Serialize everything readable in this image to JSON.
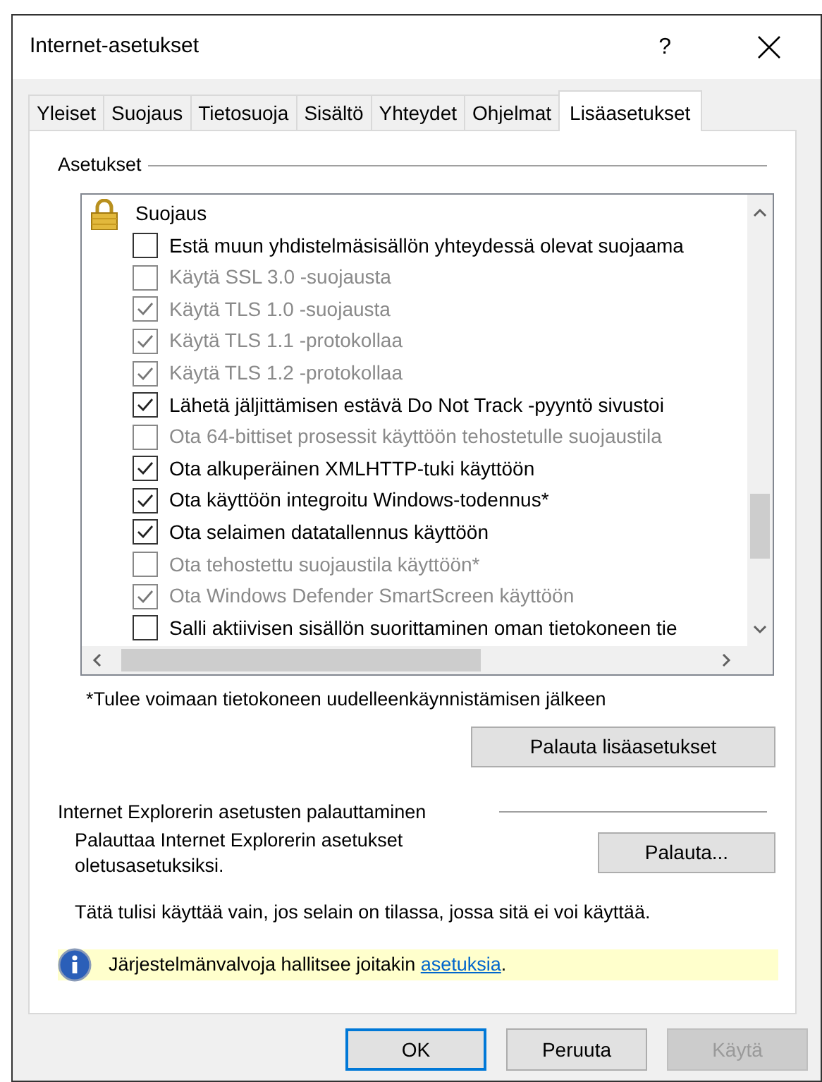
{
  "window": {
    "title": "Internet-asetukset",
    "help": "?"
  },
  "tabs": [
    {
      "label": "Yleiset",
      "selected": false
    },
    {
      "label": "Suojaus",
      "selected": false
    },
    {
      "label": "Tietosuoja",
      "selected": false
    },
    {
      "label": "Sisältö",
      "selected": false
    },
    {
      "label": "Yhteydet",
      "selected": false
    },
    {
      "label": "Ohjelmat",
      "selected": false
    },
    {
      "label": "Lisäasetukset",
      "selected": true
    }
  ],
  "settings": {
    "title": "Asetukset",
    "items": [
      {
        "kind": "category",
        "label": "Suojaus"
      },
      {
        "kind": "checkbox",
        "label": "Estä muun yhdistelmäsisällön yhteydessä olevat suojaama",
        "checked": false,
        "disabled": false
      },
      {
        "kind": "checkbox",
        "label": "Käytä SSL 3.0 -suojausta",
        "checked": false,
        "disabled": true
      },
      {
        "kind": "checkbox",
        "label": "Käytä TLS 1.0 -suojausta",
        "checked": true,
        "disabled": true
      },
      {
        "kind": "checkbox",
        "label": "Käytä TLS 1.1 -protokollaa",
        "checked": true,
        "disabled": true
      },
      {
        "kind": "checkbox",
        "label": "Käytä TLS 1.2 -protokollaa",
        "checked": true,
        "disabled": true
      },
      {
        "kind": "checkbox",
        "label": "Lähetä jäljittämisen estävä Do Not Track -pyyntö sivustoi",
        "checked": true,
        "disabled": false
      },
      {
        "kind": "checkbox",
        "label": "Ota 64-bittiset prosessit käyttöön tehostetulle suojaustila",
        "checked": false,
        "disabled": true
      },
      {
        "kind": "checkbox",
        "label": "Ota alkuperäinen XMLHTTP-tuki käyttöön",
        "checked": true,
        "disabled": false
      },
      {
        "kind": "checkbox",
        "label": "Ota käyttöön integroitu Windows-todennus*",
        "checked": true,
        "disabled": false
      },
      {
        "kind": "checkbox",
        "label": "Ota selaimen datatallennus käyttöön",
        "checked": true,
        "disabled": false
      },
      {
        "kind": "checkbox",
        "label": "Ota tehostettu suojaustila käyttöön*",
        "checked": false,
        "disabled": true
      },
      {
        "kind": "checkbox",
        "label": "Ota Windows Defender SmartScreen käyttöön",
        "checked": true,
        "disabled": true
      },
      {
        "kind": "checkbox",
        "label": "Salli aktiivisen sisällön suorittaminen oman tietokoneen tie",
        "checked": false,
        "disabled": false
      }
    ],
    "footnote": "*Tulee voimaan tietokoneen uudelleenkäynnistämisen jälkeen",
    "restore_button": "Palauta lisäasetukset"
  },
  "reset": {
    "title": "Internet Explorerin asetusten palauttaminen",
    "description": "Palauttaa Internet Explorerin asetukset oletusasetuksiksi.",
    "button": "Palauta...",
    "note": "Tätä tulisi käyttää vain, jos selain on tilassa, jossa sitä ei voi käyttää."
  },
  "info": {
    "text": "Järjestelmänvalvoja hallitsee joitakin ",
    "link": "asetuksia",
    "after": "."
  },
  "buttons": [
    {
      "label": "OK",
      "default": true,
      "disabled": false
    },
    {
      "label": "Peruuta",
      "default": false,
      "disabled": false
    },
    {
      "label": "Käytä",
      "default": false,
      "disabled": true
    }
  ]
}
